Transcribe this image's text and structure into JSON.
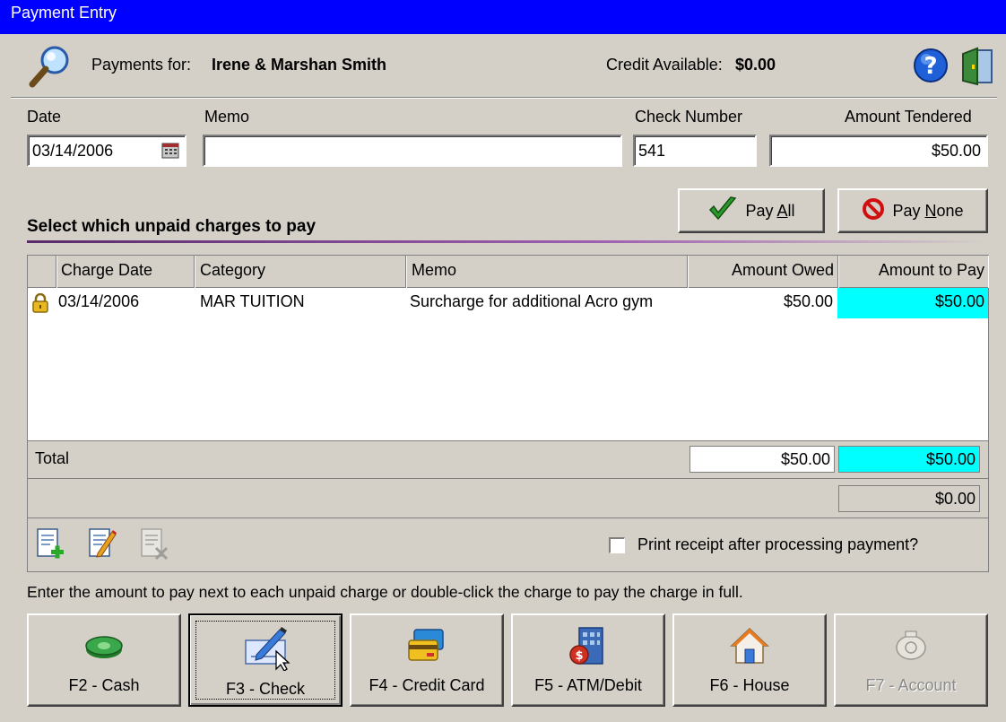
{
  "window": {
    "title": "Payment Entry"
  },
  "header": {
    "payments_for_label": "Payments for:",
    "payments_for_value": "Irene & Marshan Smith",
    "credit_label": "Credit Available:",
    "credit_value": "$0.00",
    "icons": [
      "search-icon",
      "help-icon",
      "exit-door-icon"
    ]
  },
  "form": {
    "date_label": "Date",
    "date_value": "03/14/2006",
    "memo_label": "Memo",
    "memo_value": "",
    "check_label": "Check Number",
    "check_value": "541",
    "amount_label": "Amount Tendered",
    "amount_value": "$50.00"
  },
  "actions": {
    "pay_all_prefix": "Pay ",
    "pay_all_key": "A",
    "pay_all_suffix": "ll",
    "pay_none_prefix": "Pay ",
    "pay_none_key": "N",
    "pay_none_suffix": "one"
  },
  "section_title": "Select which unpaid charges to pay",
  "grid": {
    "columns": [
      "Charge Date",
      "Category",
      "Memo",
      "Amount Owed",
      "Amount to Pay"
    ],
    "rows": [
      {
        "icon": "lock-icon",
        "charge_date": "03/14/2006",
        "category": "MAR TUITION",
        "memo": "Surcharge for additional Acro gym",
        "amount_owed": "$50.00",
        "amount_to_pay": "$50.00"
      }
    ],
    "total_label": "Total",
    "total_owed": "$50.00",
    "total_to_pay": "$50.00",
    "remaining": "$0.00"
  },
  "print_receipt": {
    "label": "Print receipt after processing payment?",
    "checked": false
  },
  "hint": "Enter the amount to pay next to each unpaid charge or double-click the charge to pay the charge in full.",
  "payment_methods": [
    {
      "label": "F2 - Cash",
      "icon": "cash-icon",
      "enabled": true
    },
    {
      "label": "F3 - Check",
      "icon": "check-icon",
      "enabled": true
    },
    {
      "label": "F4 - Credit Card",
      "icon": "credit-card-icon",
      "enabled": true
    },
    {
      "label": "F5 - ATM/Debit",
      "icon": "atm-icon",
      "enabled": true
    },
    {
      "label": "F6 - House",
      "icon": "house-icon",
      "enabled": true
    },
    {
      "label": "F7 - Account",
      "icon": "piggy-bank-icon",
      "enabled": false
    }
  ],
  "colors": {
    "titlebar": "#0000ff",
    "highlight": "#00ffff",
    "face": "#d4d0c8"
  }
}
